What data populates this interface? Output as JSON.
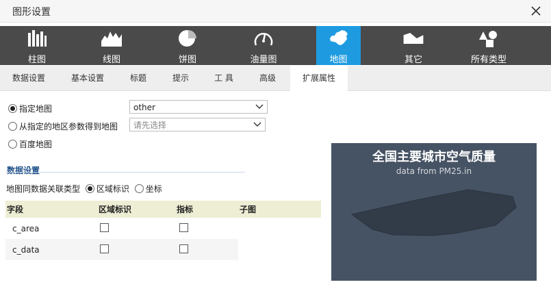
{
  "dialog": {
    "title": "图形设置"
  },
  "toolbar": {
    "items": [
      {
        "label": "柱图",
        "icon": "bar-chart-icon"
      },
      {
        "label": "线图",
        "icon": "line-chart-icon"
      },
      {
        "label": "饼图",
        "icon": "pie-chart-icon"
      },
      {
        "label": "油量图",
        "icon": "gauge-icon"
      },
      {
        "label": "地图",
        "icon": "map-icon",
        "active": true
      },
      {
        "label": "其它",
        "icon": "other-chart-icon"
      },
      {
        "label": "所有类型",
        "icon": "shapes-icon"
      }
    ],
    "active_color": "#1e9be0"
  },
  "tabs": [
    {
      "label": "数据设置"
    },
    {
      "label": "基本设置"
    },
    {
      "label": "标题"
    },
    {
      "label": "提示"
    },
    {
      "label": "工 具"
    },
    {
      "label": "高级"
    },
    {
      "label": "扩展属性",
      "active": true
    }
  ],
  "map_source": {
    "option_specified": "指定地图",
    "option_from_param": "从指定的地区参数得到地图",
    "option_baidu": "百度地图",
    "selected": "specified",
    "specified_value": "other",
    "param_placeholder": "请先选择"
  },
  "data_settings": {
    "section_title": "数据设置",
    "link_type_label": "地图同数据关联类型",
    "link_option_region": "区域标识",
    "link_option_coord": "坐标",
    "link_selected": "region",
    "columns": [
      "字段",
      "区域标识",
      "指标",
      "子图"
    ],
    "rows": [
      {
        "field": "c_area",
        "region": false,
        "metric": false
      },
      {
        "field": "c_data",
        "region": false,
        "metric": false
      }
    ]
  },
  "preview": {
    "title": "全国主要城市空气质量",
    "subtitle": "data from PM25.in",
    "background": "#465364",
    "shape_fill": "#323c48"
  }
}
